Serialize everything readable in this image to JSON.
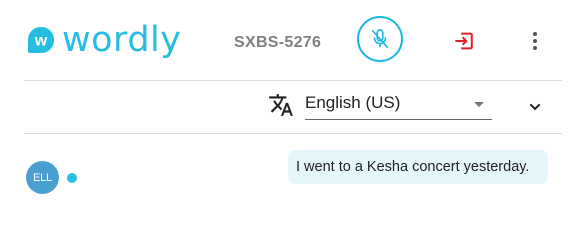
{
  "header": {
    "brand": "wordly",
    "brand_badge": "w",
    "session_code": "SXBS-5276",
    "mic_icon": "mic-off-icon",
    "exit_icon": "exit-icon",
    "menu_icon": "more-vertical-icon"
  },
  "language_bar": {
    "icon": "translate-icon",
    "selected_language": "English (US)",
    "expand_icon": "chevron-down-icon"
  },
  "messages": [
    {
      "avatar_initials": "ELL",
      "text": "I went to a Kesha concert yesterday."
    }
  ],
  "colors": {
    "brand": "#27bde0",
    "mic_ring": "#1fb6df",
    "exit": "#e0202a",
    "avatar": "#4a9fd1",
    "status_dot": "#27c0e4",
    "bubble": "#e6f7fc"
  }
}
